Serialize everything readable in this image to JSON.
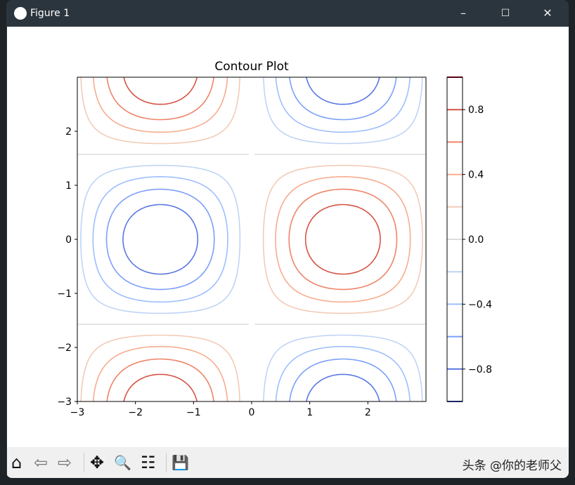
{
  "window": {
    "title": "Figure 1",
    "minimize": "–",
    "maximize": "☐",
    "close": "✕"
  },
  "toolbar": {
    "home": "⌂",
    "back": "⇦",
    "forward": "⇨",
    "pan": "✥",
    "zoom": "🔍",
    "configure": "☷",
    "save": "💾",
    "watermark": "头条 @你的老师父"
  },
  "chart_data": {
    "type": "contour",
    "title": "Contour Plot",
    "function": "sin(x)*cos(y)",
    "xlim": [
      -3,
      3
    ],
    "ylim": [
      -3,
      3
    ],
    "xticks": [
      "−3",
      "−2",
      "−1",
      "0",
      "1",
      "2"
    ],
    "yticks": [
      "−3",
      "−2",
      "−1",
      "0",
      "1",
      "2"
    ],
    "levels": [
      -1,
      -0.8,
      -0.6,
      -0.4,
      -0.2,
      0,
      0.2,
      0.4,
      0.6,
      0.8,
      1
    ],
    "level_colors": [
      "#3b4cc0",
      "#5977e3",
      "#7b9ff9",
      "#9ebeff",
      "#c0d4f5",
      "#dddcdc",
      "#f2cbb7",
      "#f7ac8e",
      "#ee8468",
      "#d65244",
      "#b40426"
    ],
    "colorbar": {
      "ticks": [
        "0.8",
        "0.4",
        "0.0",
        "−0.4",
        "−0.8"
      ],
      "tick_values": [
        0.8,
        0.4,
        0,
        -0.4,
        -0.8
      ],
      "range": [
        -1,
        1
      ]
    },
    "colormap": "coolwarm"
  }
}
